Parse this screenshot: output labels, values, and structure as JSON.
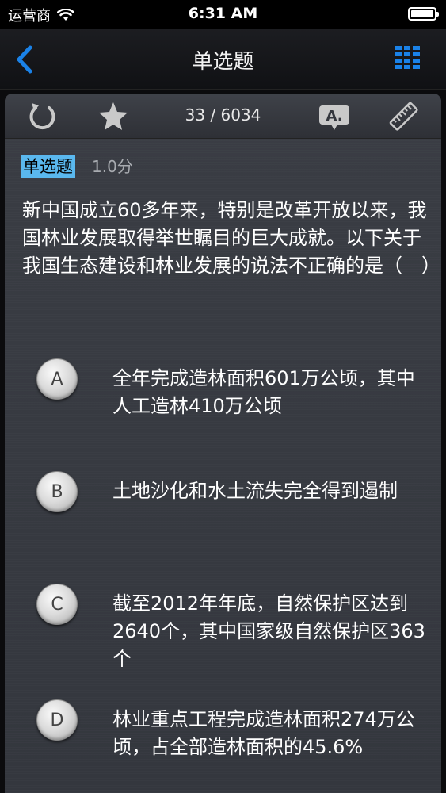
{
  "status_bar": {
    "carrier": "运营商",
    "time": "6:31 AM",
    "icons": [
      "wifi-icon",
      "battery-icon"
    ]
  },
  "nav": {
    "title": "单选题",
    "back_icon": "chevron-left-icon",
    "menu_icon": "grid-list-icon",
    "accent_color": "#1a82e8"
  },
  "toolbar": {
    "counter": "33 / 6034",
    "icons": [
      "refresh-icon",
      "star-icon",
      "answer-bubble-icon",
      "ruler-icon"
    ]
  },
  "question": {
    "type": "单选题",
    "score": "1.0分",
    "text": "新中国成立60多年来，特别是改革开放以来，我国林业发展取得举世瞩目的巨大成就。以下关于我国生态建设和林业发展的说法不正确的是（　）",
    "options": [
      {
        "letter": "A",
        "text": "全年完成造林面积601万公顷，其中人工造林410万公顷"
      },
      {
        "letter": "B",
        "text": "土地沙化和水土流失完全得到遏制"
      },
      {
        "letter": "C",
        "text": "截至2012年年底，自然保护区达到2640个，其中国家级自然保护区363个"
      },
      {
        "letter": "D",
        "text": "林业重点工程完成造林面积274万公顷，占全部造林面积的45.6%"
      }
    ]
  },
  "colors": {
    "highlight": "#5ab8ee",
    "card_bg": "#383b42"
  }
}
